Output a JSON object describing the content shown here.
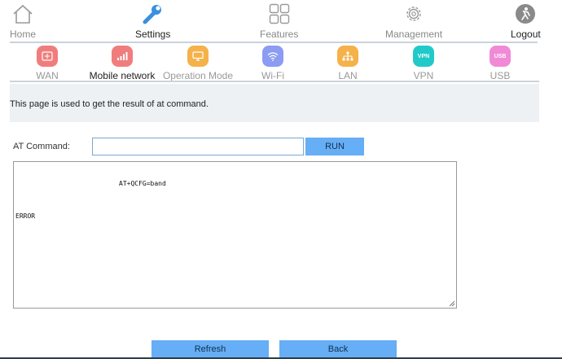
{
  "topnav": {
    "items": [
      {
        "label": "Home",
        "icon": "home-icon"
      },
      {
        "label": "Settings",
        "icon": "wrench-icon"
      },
      {
        "label": "Features",
        "icon": "grid-icon"
      },
      {
        "label": "Management",
        "icon": "gear-icon"
      },
      {
        "label": "Logout",
        "icon": "logout-icon"
      }
    ],
    "active": "Settings"
  },
  "subnav": {
    "items": [
      {
        "label": "WAN",
        "icon": "wan-icon",
        "color": "#f07d7d"
      },
      {
        "label": "Mobile network",
        "icon": "signal-icon",
        "color": "#f07d7d"
      },
      {
        "label": "Operation Mode",
        "icon": "monitor-icon",
        "color": "#f5b14a"
      },
      {
        "label": "Wi-Fi",
        "icon": "wifi-icon",
        "color": "#8c9cf2"
      },
      {
        "label": "LAN",
        "icon": "lan-icon",
        "color": "#f5b14a"
      },
      {
        "label": "VPN",
        "icon": "vpn-icon",
        "badge": "VPN",
        "color": "#22c9c9"
      },
      {
        "label": "USB",
        "icon": "usb-icon",
        "badge": "USB",
        "color": "#f08ad6"
      }
    ],
    "active": "Mobile network"
  },
  "info_text": "This page is used to get the result of at command.",
  "at_command": {
    "label": "AT Command:",
    "value": "",
    "run_label": "RUN"
  },
  "result": {
    "line1": "AT+QCFG=band",
    "line2": "ERROR"
  },
  "buttons": {
    "refresh": "Refresh",
    "back": "Back"
  },
  "colors": {
    "button_bg": "#66aef5",
    "divider": "#c9d3dc",
    "info_bg": "#edf1f4"
  }
}
